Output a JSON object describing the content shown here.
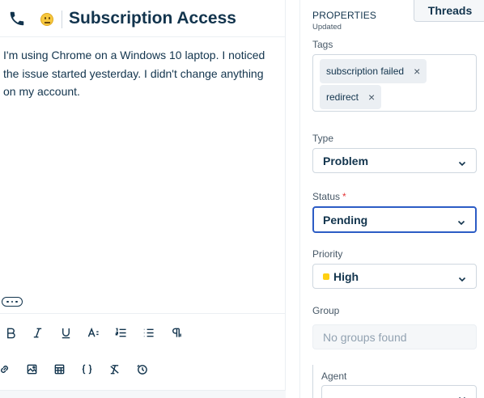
{
  "ticket": {
    "title": "Subscription Access",
    "body_lines": [
      "I'm using Chrome on a Windows 10 laptop. I noticed",
      "the issue started yesterday. I didn't change anything",
      "on my account."
    ]
  },
  "toolbar": {
    "row1": [
      "bold-icon",
      "italic-icon",
      "underline-icon",
      "font-size-icon",
      "numbered-list-icon",
      "bulleted-list-icon",
      "paragraph-icon"
    ],
    "row2": [
      "link-icon",
      "image-icon",
      "table-icon",
      "code-icon",
      "clear-format-icon",
      "canned-response-icon"
    ]
  },
  "properties": {
    "heading": "PROPERTIES",
    "status_note": "Updated",
    "threads_tab": "Threads",
    "tags_label": "Tags",
    "tags": [
      "subscription failed",
      "redirect"
    ],
    "tag_remove": "×",
    "type_label": "Type",
    "type_value": "Problem",
    "status_label": "Status",
    "status_required": "*",
    "status_value": "Pending",
    "priority_label": "Priority",
    "priority_value": "High",
    "priority_color": "#ffd012",
    "group_label": "Group",
    "group_placeholder": "No groups found",
    "agent_label": "Agent"
  },
  "colors": {
    "text": "#12344d",
    "focus": "#2c5cc5",
    "required": "#e43538"
  }
}
